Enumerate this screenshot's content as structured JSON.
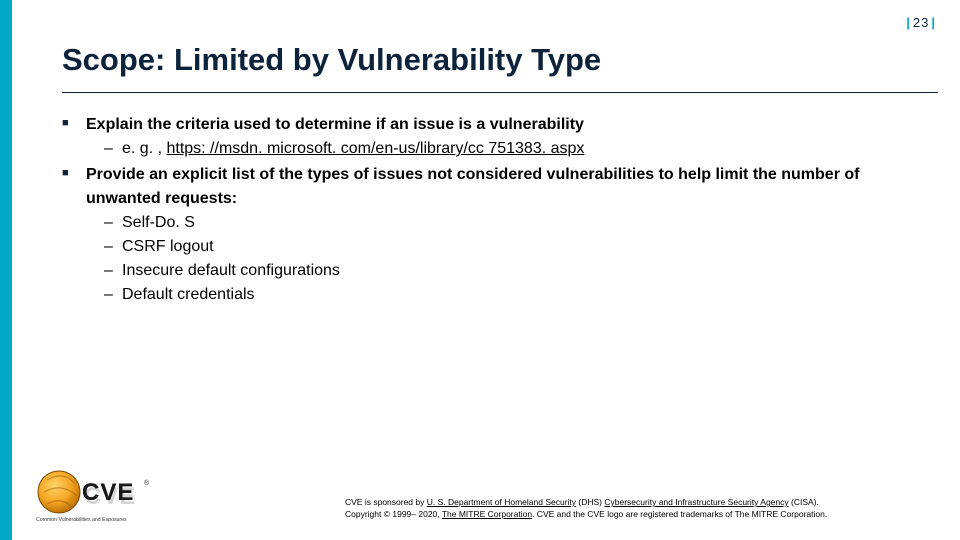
{
  "page": {
    "number": "23"
  },
  "title": "Scope: Limited by Vulnerability Type",
  "bullets": [
    {
      "lead": "Explain the criteria used to determine if an issue is a vulnerability",
      "sub": [
        {
          "prefix": "e. g. , ",
          "link": "https: //msdn. microsoft. com/en-us/library/cc 751383. aspx"
        }
      ]
    },
    {
      "lead": "Provide an explicit list of the types of issues not considered vulnerabilities to help limit the number of unwanted requests:",
      "sub": [
        {
          "text": "Self-Do. S"
        },
        {
          "text": "CSRF logout"
        },
        {
          "text": "Insecure default configurations"
        },
        {
          "text": "Default credentials"
        }
      ]
    }
  ],
  "logo": {
    "label": "CVE",
    "tagline": "Common Vulnerabilities and Exposures"
  },
  "footer": {
    "line1_a": "CVE is sponsored by ",
    "link1": "U. S. Department of Homeland Security",
    "line1_b": " (DHS) ",
    "link2": "Cybersecurity and Infrastructure Security Agency",
    "line1_c": " (CISA).",
    "line2_a": "Copyright © 1999– 2020, ",
    "link3": "The MITRE Corporation",
    "line2_b": ". CVE and the CVE logo are registered trademarks of The MITRE Corporation."
  }
}
